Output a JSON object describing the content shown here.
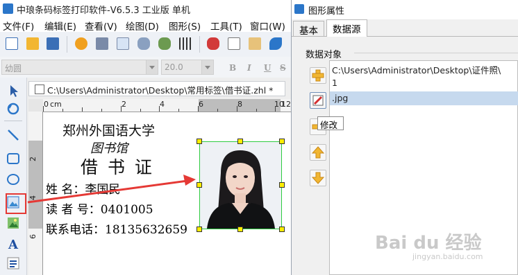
{
  "app": {
    "title": "中琅条码标签打印软件-V6.5.3 工业版 单机"
  },
  "menu": [
    "文件(F)",
    "编辑(E)",
    "查看(V)",
    "绘图(D)",
    "图形(S)",
    "工具(T)",
    "窗口(W)"
  ],
  "toolbar2": {
    "font_name": "幼圆",
    "font_size": "20.0",
    "bold": "B",
    "italic": "I",
    "underline": "U",
    "strike": "S",
    "align_left": "≡"
  },
  "document": {
    "tab_title": "C:\\Users\\Administrator\\Desktop\\常用标签\\借书证.zhl *",
    "ruler_top": [
      "0",
      "cm",
      "2",
      "4",
      "6",
      "8",
      "10",
      "12"
    ],
    "ruler_left": [
      "2",
      "4",
      "6"
    ]
  },
  "label": {
    "line1": "郑州外国语大学",
    "line2": "图书馆",
    "line3": "借 书 证",
    "name_row": "姓    名：李国民",
    "reader_row": "读 者 号：0401005",
    "phone_row": "联系电话：18135632659"
  },
  "dialog": {
    "title": "图形属性",
    "tabs": [
      "基本",
      "数据源"
    ],
    "group_label": "数据对象",
    "list_lines": [
      "C:\\Users\\Administrator\\Desktop\\证件照\\",
      "1",
      ".jpg"
    ],
    "tooltip": "修改"
  },
  "watermark": {
    "brand": "Bai du 经验",
    "url": "jingyan.baidu.com"
  },
  "colors": {
    "accent": "#2b76c9",
    "selection_green": "#2ecc40",
    "handle_yellow": "#ffee00",
    "annotation_red": "#e53935",
    "list_selection": "#c6d9ee"
  }
}
